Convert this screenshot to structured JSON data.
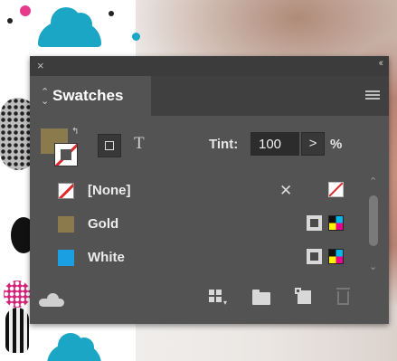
{
  "panel": {
    "close_glyph": "×",
    "collapse_glyph": "‹‹",
    "tab_label": "Swatches",
    "tab_arrows": "⌃⌄"
  },
  "controls": {
    "tint_label": "Tint:",
    "tint_value": "100",
    "tint_arrow": ">",
    "tint_unit": "%",
    "format_text_glyph": "T",
    "swap_glyph": "↰"
  },
  "swatches": [
    {
      "name": "[None]",
      "chip": "none",
      "icons": [
        "non-editable-icon",
        "none-type-icon"
      ]
    },
    {
      "name": "Gold",
      "chip_color": "#8b7a4b",
      "icons": [
        "spot-color-icon",
        "cmyk-mode-icon"
      ]
    },
    {
      "name": "White",
      "chip_color": "#1a9fe3",
      "icons": [
        "spot-color-icon",
        "cmyk-mode-icon"
      ]
    }
  ],
  "colors": {
    "fill": "#8b7a4b",
    "stroke_none_red": "#e0282a",
    "panel_bg": "#535353",
    "accent_cyan": "#1aa6c4"
  },
  "toolbar": {
    "icons": [
      "cc-libraries-icon",
      "show-swatch-kinds-icon",
      "new-color-group-icon",
      "new-swatch-icon",
      "delete-swatch-icon"
    ]
  }
}
